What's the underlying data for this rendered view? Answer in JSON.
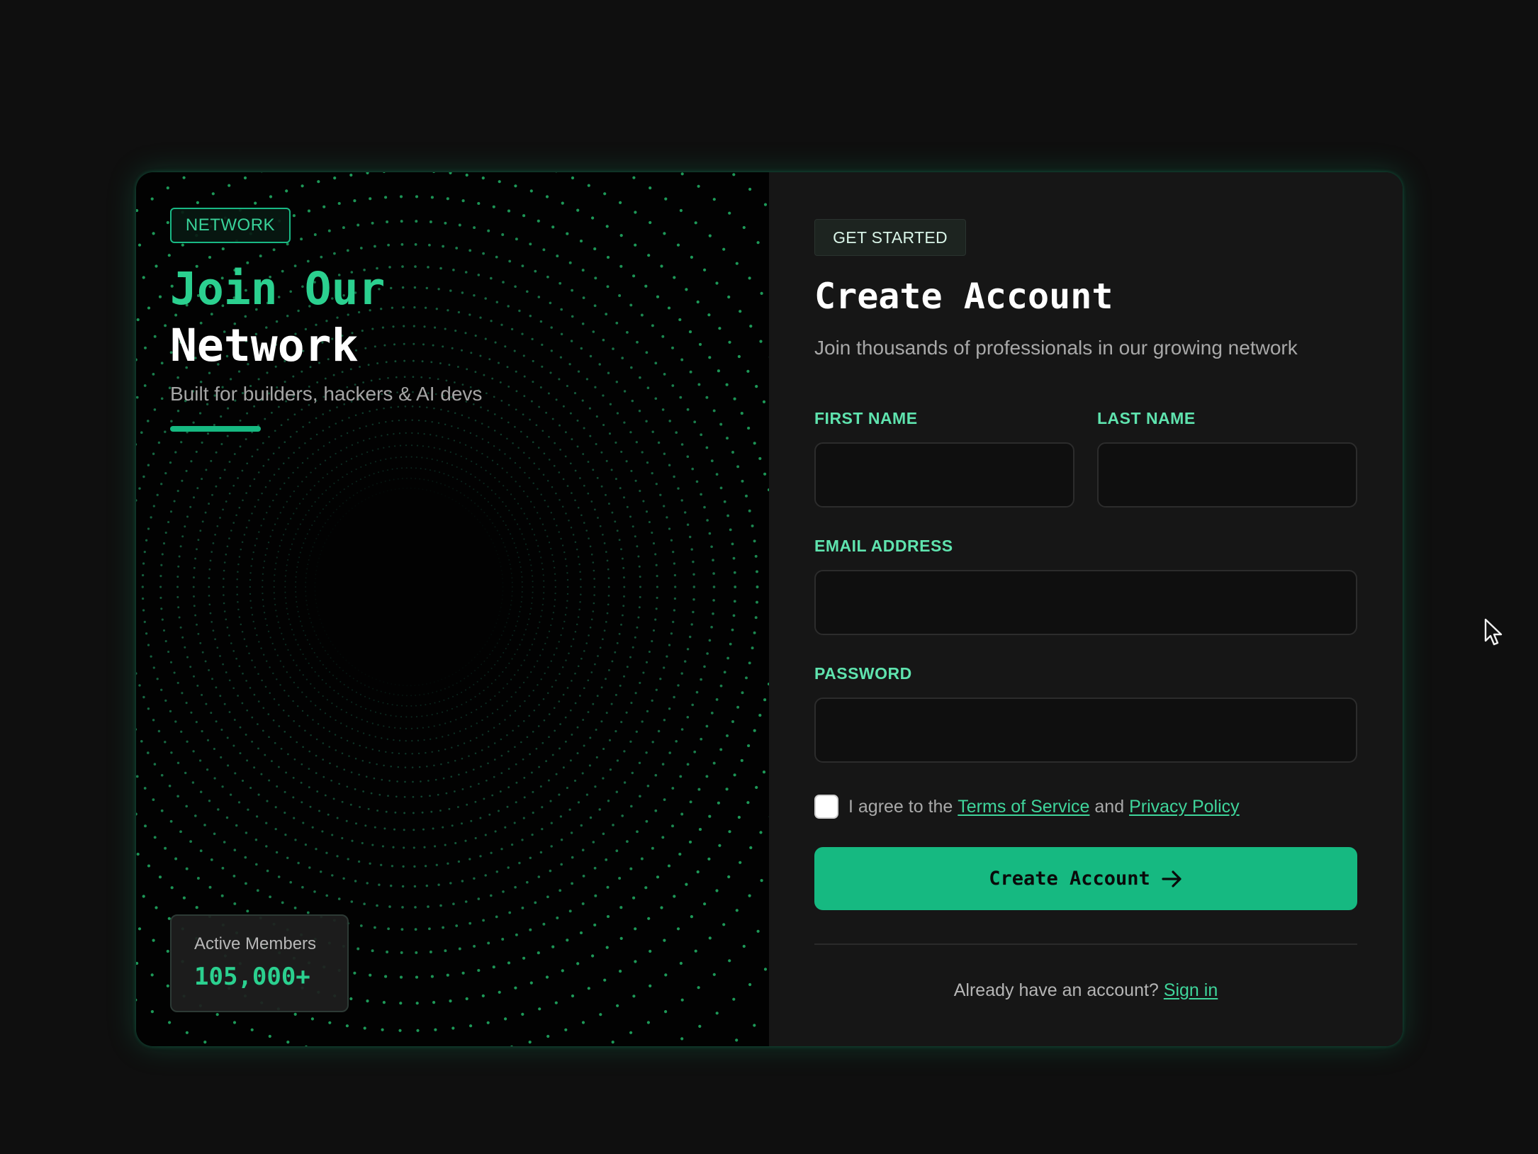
{
  "hero": {
    "badge": "NETWORK",
    "title_line1": "Join Our",
    "title_line2": "Network",
    "subtitle": "Built for builders, hackers & AI devs",
    "stat_label": "Active Members",
    "stat_value": "105,000+"
  },
  "form": {
    "badge": "GET STARTED",
    "title": "Create Account",
    "subtitle": "Join thousands of professionals in our growing network",
    "first_name_label": "FIRST NAME",
    "first_name_value": "",
    "last_name_label": "LAST NAME",
    "last_name_value": "",
    "email_label": "EMAIL ADDRESS",
    "email_value": "",
    "password_label": "PASSWORD",
    "password_value": "",
    "agree_prefix": "I agree to the",
    "terms_link": "Terms of Service",
    "agree_and": "and",
    "privacy_link": "Privacy Policy",
    "agree_checked": false,
    "submit_label": "Create Account",
    "signin_prompt": "Already have an account?",
    "signin_link": "Sign in"
  },
  "icons": {
    "submit_icon": "arrow-right-icon",
    "cursor": "mouse-pointer-icon"
  },
  "colors": {
    "accent": "#16b981",
    "accent_text": "#2bd08f",
    "label": "#5fe3ae",
    "background": "#0f0f0f",
    "card": "#161616",
    "left_panel": "#020202"
  }
}
